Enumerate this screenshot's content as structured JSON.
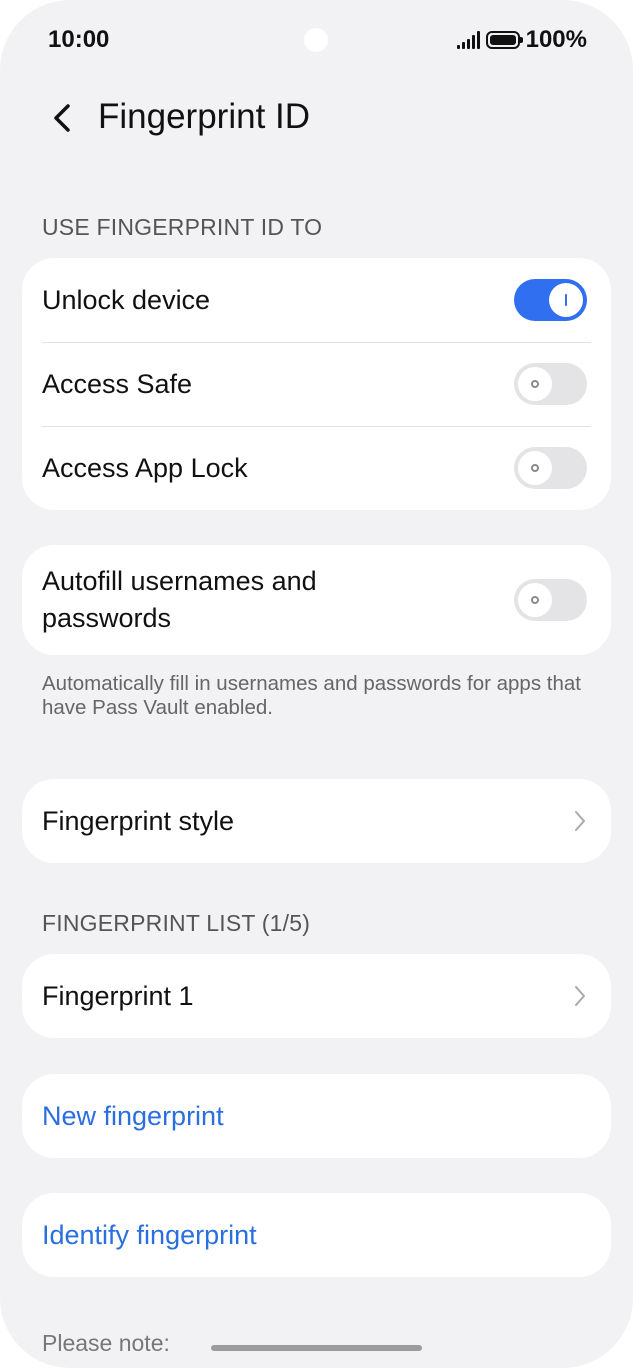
{
  "status": {
    "time": "10:00",
    "battery": "100%"
  },
  "header": {
    "title": "Fingerprint ID"
  },
  "use_section": {
    "label": "USE FINGERPRINT ID TO",
    "items": [
      {
        "label": "Unlock device",
        "toggle": "on"
      },
      {
        "label": "Access Safe",
        "toggle": "off"
      },
      {
        "label": "Access App Lock",
        "toggle": "off"
      }
    ]
  },
  "autofill": {
    "label_line1": "Autofill usernames and",
    "label_line2": "passwords",
    "toggle": "off",
    "description": "Automatically fill in usernames and passwords for apps that have Pass Vault enabled."
  },
  "style_row": {
    "label": "Fingerprint style"
  },
  "list_section": {
    "label": "FINGERPRINT LIST (1/5)",
    "items": [
      {
        "label": "Fingerprint 1"
      }
    ]
  },
  "actions": {
    "new_label": "New fingerprint",
    "identify_label": "Identify fingerprint"
  },
  "footer": {
    "note": "Please note:"
  },
  "colors": {
    "accent": "#2f6ff0",
    "link": "#2a6fe0",
    "background": "#f2f2f4"
  }
}
